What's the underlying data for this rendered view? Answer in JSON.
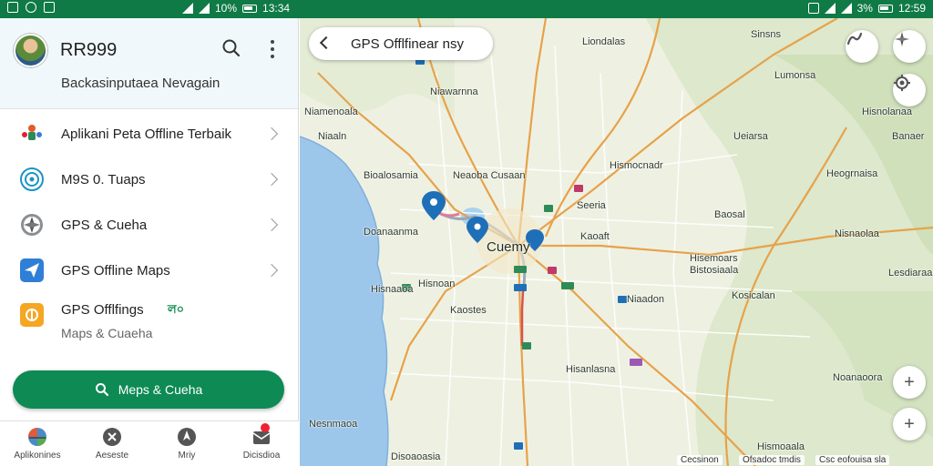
{
  "status_bar": {
    "left_time": "13:34",
    "left_battery": "10%",
    "right_time": "12:59",
    "right_battery": "3%"
  },
  "panel": {
    "username": "RR999",
    "subtitle": "Backasinputaea Nevagain",
    "menu": [
      {
        "label": "Aplikani Peta Offline Terbaik",
        "icon": "map-pin-people-icon"
      },
      {
        "label": "M9S 0. Tuaps",
        "icon": "target-icon"
      },
      {
        "label": "GPS & Cueha",
        "icon": "compass-icon"
      },
      {
        "label": "GPS Offline Maps",
        "icon": "send-arrow-icon"
      },
      {
        "label": "GPS Offlfings",
        "sublabel": "Maps & Cuaeha",
        "badge": "ল০",
        "icon": "gps-app-icon"
      }
    ],
    "cta_label": "Meps & Cueha",
    "bottom_nav": [
      {
        "label": "Aplikonines",
        "icon": "map-pie-icon"
      },
      {
        "label": "Aeseste",
        "icon": "close-circle-icon"
      },
      {
        "label": "Mriy",
        "icon": "navigation-icon"
      },
      {
        "label": "Dicisdioa",
        "icon": "inbox-icon"
      }
    ]
  },
  "map": {
    "search_text": "GPS Offlfinear nsy",
    "city_label": "Cuemy",
    "labels": [
      "Liondalas",
      "Sinsns",
      "Niawarnna",
      "Lumonsa",
      "Niamenoala",
      "Hisnolanaa",
      "Niaaln",
      "Ueiarsa",
      "Banaer",
      "Heogrnaisa",
      "Bioalosamia",
      "Neaoba Cusaan",
      "Hismocnadr",
      "Seeria",
      "Baosal",
      "Doanaanma",
      "Kaoaft",
      "Nisnaolaa",
      "Hisemoars",
      "Bistosiaala",
      "Hisnoan",
      "Hisnaaoa",
      "Kosicalan",
      "Niaadon",
      "Kaostes",
      "Lesdiaraa",
      "Hisanlasna",
      "Noanaoora",
      "Nesnmaoa",
      "Disoaoasia",
      "Hismoaala"
    ],
    "attribution_left": "Cecsinon",
    "attribution_mid": "Ofsadoc tmdis",
    "attribution_right": "Csc eofouisa sla"
  }
}
